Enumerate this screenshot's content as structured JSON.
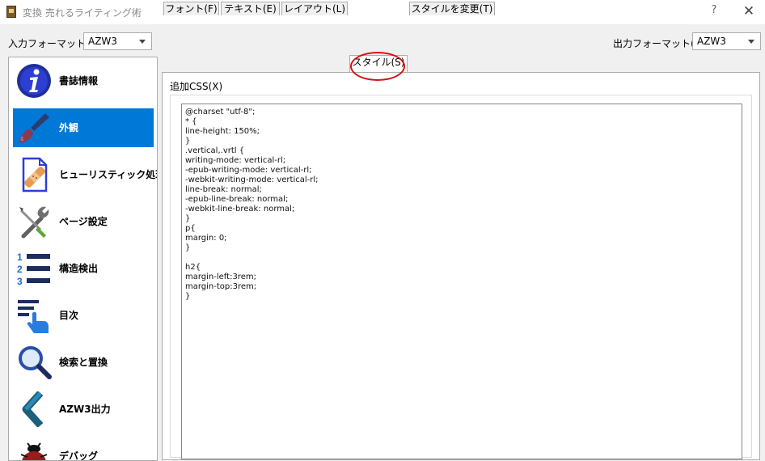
{
  "window": {
    "title": "変換 売れるライティング術",
    "help": "?",
    "close": "✕"
  },
  "input_format": {
    "label": "入力フォーマット(I):",
    "value": "AZW3"
  },
  "output_format": {
    "label": "出力フォーマット(O):",
    "value": "AZW3"
  },
  "sidebar": {
    "items": [
      {
        "label": "書誌情報",
        "icon": "info-icon",
        "selected": false
      },
      {
        "label": "外観",
        "icon": "paintbrush-icon",
        "selected": true
      },
      {
        "label": "ヒューリスティック処理",
        "icon": "bandage-document-icon",
        "selected": false
      },
      {
        "label": "ページ設定",
        "icon": "tools-icon",
        "selected": false
      },
      {
        "label": "構造検出",
        "icon": "numbered-list-icon",
        "selected": false
      },
      {
        "label": "目次",
        "icon": "toc-pointer-icon",
        "selected": false
      },
      {
        "label": "検索と置換",
        "icon": "magnifier-icon",
        "selected": false
      },
      {
        "label": "AZW3出力",
        "icon": "chevron-left-icon",
        "selected": false
      },
      {
        "label": "デバッグ",
        "icon": "bug-icon",
        "selected": false
      }
    ]
  },
  "tabs": [
    {
      "label": "フォント(F)",
      "active": false
    },
    {
      "label": "テキスト(E)",
      "active": false
    },
    {
      "label": "レイアウト(L)",
      "active": false
    },
    {
      "label": "スタイル(S)",
      "active": true,
      "highlighted": true
    },
    {
      "label": "スタイルを変更(T)",
      "active": false
    }
  ],
  "extra_css": {
    "label": "追加CSS(X)",
    "lines": [
      "@charset \"utf-8\";",
      "* {",
      "line-height: 150%;",
      "}",
      ".vertical,.vrtl {",
      "writing-mode: vertical-rl;",
      "-epub-writing-mode: vertical-rl;",
      "-webkit-writing-mode: vertical-rl;",
      "line-break: normal;",
      "-epub-line-break: normal;",
      "-webkit-line-break: normal;",
      "}",
      "p{",
      "margin: 0;",
      "}",
      "",
      "h2{",
      "margin-left:3rem;",
      "margin-top:3rem;",
      "}"
    ]
  },
  "colors": {
    "selection": "#0078d7",
    "highlight_circle": "#d80f0f",
    "window_bg": "#f0f0f0"
  }
}
